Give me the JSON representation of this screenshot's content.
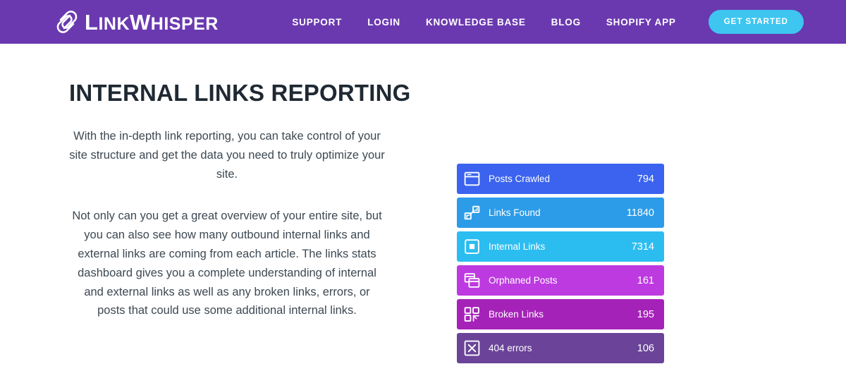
{
  "header": {
    "brand": {
      "icon": "link-paperclip-icon",
      "name_part1": "L",
      "name_part2": "INK",
      "name_part3": "W",
      "name_part4": "HISPER"
    },
    "nav": [
      {
        "label": "SUPPORT",
        "name": "nav-link-support"
      },
      {
        "label": "LOGIN",
        "name": "nav-link-login"
      },
      {
        "label": "KNOWLEDGE BASE",
        "name": "nav-link-knowledge-base"
      },
      {
        "label": "BLOG",
        "name": "nav-link-blog"
      },
      {
        "label": "SHOPIFY APP",
        "name": "nav-link-shopify-app"
      }
    ],
    "cta_label": "GET STARTED",
    "background_color": "#6a39b0",
    "cta_color": "#3ec6f0"
  },
  "main": {
    "title": "INTERNAL LINKS REPORTING",
    "paragraph1": "With the in-depth link reporting, you can take control of your site structure and get the data you need to truly optimize your site.",
    "paragraph2": "Not only can you get a great overview of your entire site, but you can also see how many outbound internal links and external links are coming from each article. The links stats dashboard gives you a complete understanding of internal and external links as well as any broken links, errors, or posts that could use some additional internal links."
  },
  "stats": [
    {
      "label": "Posts Crawled",
      "value": "794",
      "color": "#3b63ef",
      "icon": "browser-window-icon"
    },
    {
      "label": "Links Found",
      "value": "11840",
      "color": "#2c9ce8",
      "icon": "link-nodes-icon"
    },
    {
      "label": "Internal Links",
      "value": "7314",
      "color": "#2cbdf0",
      "icon": "square-in-square-icon"
    },
    {
      "label": "Orphaned Posts",
      "value": "161",
      "color": "#bd3ae0",
      "icon": "stacked-windows-icon"
    },
    {
      "label": "Broken Links",
      "value": "195",
      "color": "#a522b8",
      "icon": "broken-link-icon"
    },
    {
      "label": "404 errors",
      "value": "106",
      "color": "#6b4499",
      "icon": "x-close-icon"
    }
  ]
}
